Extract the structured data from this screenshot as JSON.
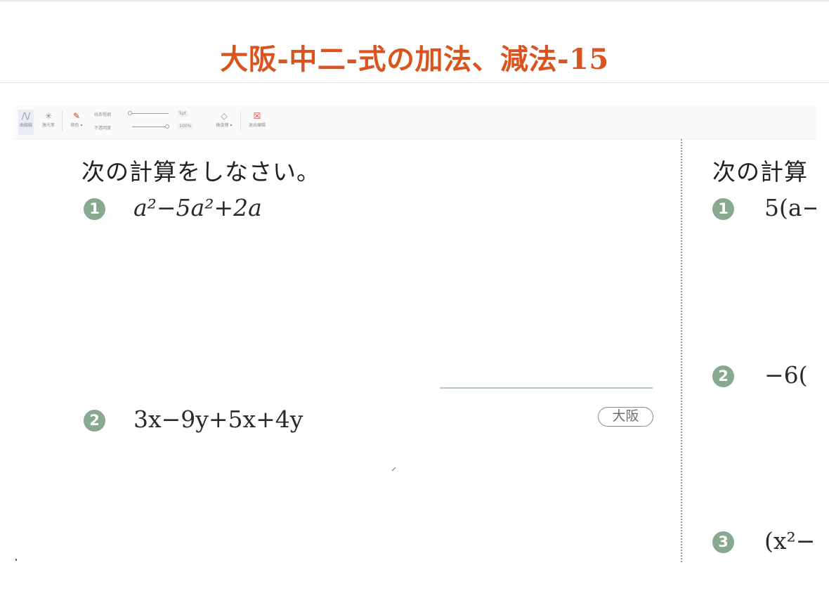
{
  "page": {
    "title": "大阪-中二-式の加法、減法-15",
    "title_color": "#d9541e"
  },
  "toolbar": {
    "tools": [
      {
        "icon": "curve-pen-icon",
        "glyph": "/\\/",
        "label": "曲線線"
      },
      {
        "icon": "laser-pointer-icon",
        "glyph": "✳",
        "label": "激光笔"
      },
      {
        "icon": "pen-color-icon",
        "glyph": "✎",
        "label": "颜色 ▾"
      },
      {
        "icon": "eraser-icon",
        "glyph": "◇",
        "label": "橡皮擦 ▾"
      },
      {
        "icon": "exit-edit-icon",
        "glyph": "☒",
        "label": "退出编辑"
      }
    ],
    "line_width_label": "线条粗细",
    "opacity_label": "不透明度",
    "font_size_value": "5pt",
    "zoom_value": "100%"
  },
  "left_page": {
    "instruction": "次の計算をしなさい。",
    "problems": [
      {
        "number": "1",
        "expression": "a²−5a²+2a"
      },
      {
        "number": "2",
        "expression": "3x−9y+5x+4y"
      }
    ],
    "region_tag": "大阪"
  },
  "right_page": {
    "instruction": "次の計算",
    "problems": [
      {
        "number": "1",
        "expression": "5(a−"
      },
      {
        "number": "2",
        "expression": "−6("
      },
      {
        "number": "3",
        "expression": "(x²−"
      }
    ]
  },
  "colors": {
    "accent": "#d9541e",
    "number_badge": "#86a98f",
    "pen_red": "#d9342b"
  }
}
